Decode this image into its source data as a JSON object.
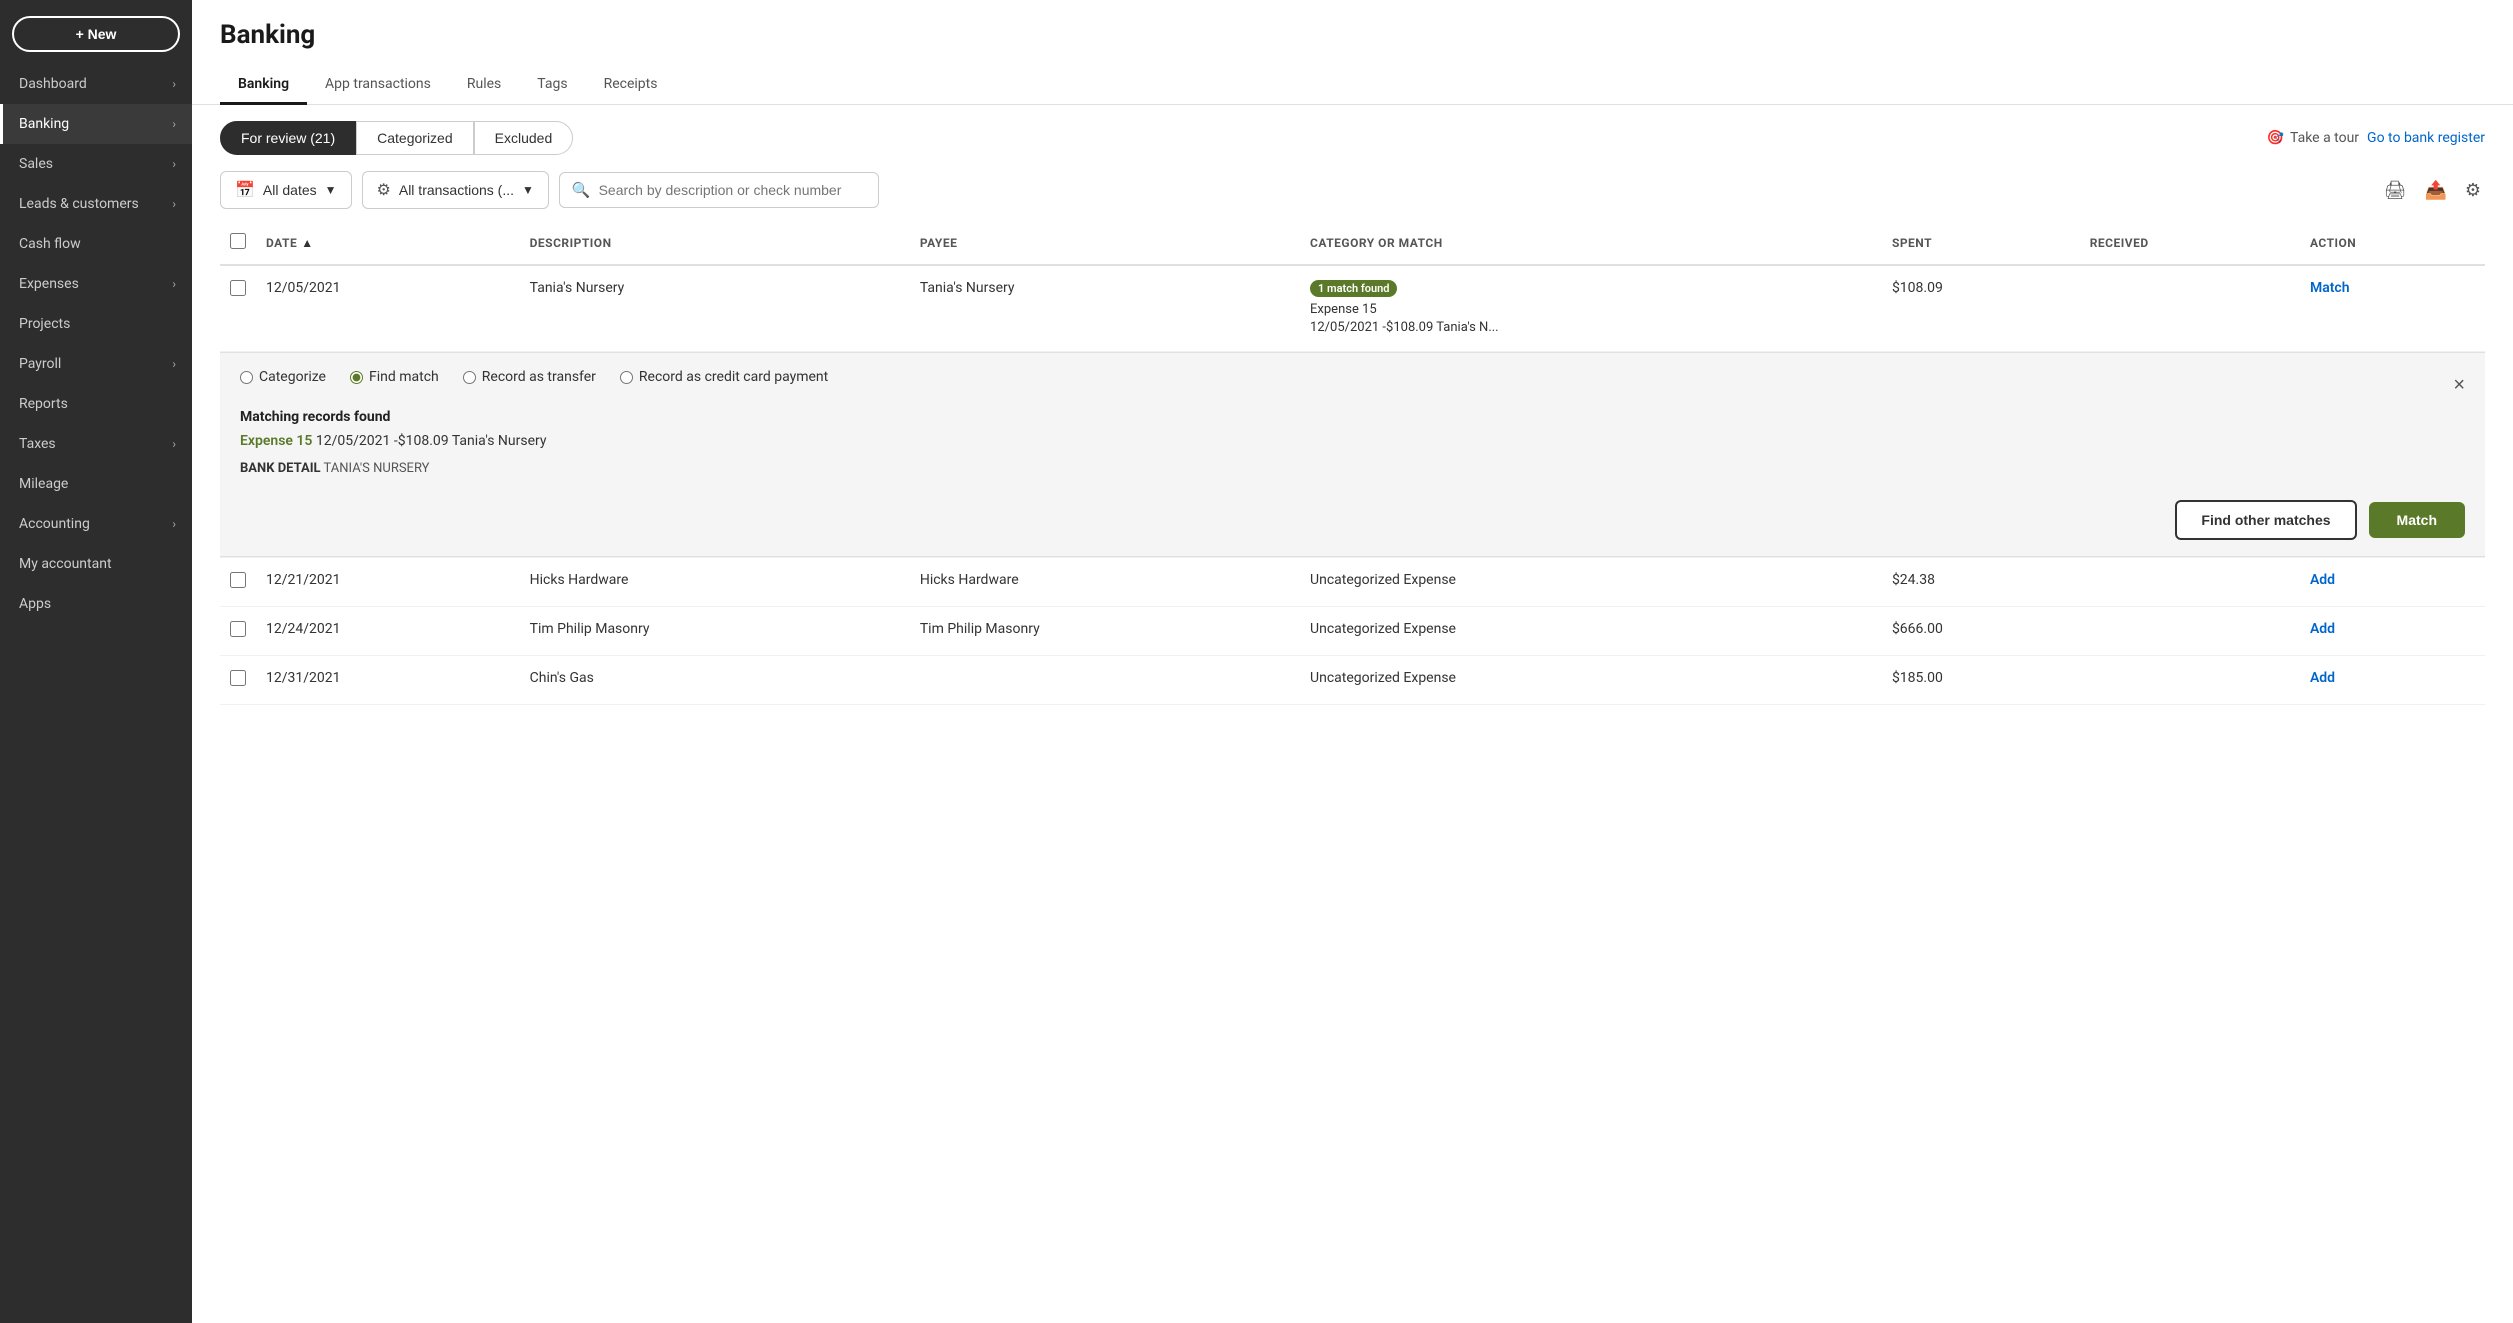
{
  "sidebar": {
    "new_button": "+ New",
    "items": [
      {
        "id": "dashboard",
        "label": "Dashboard",
        "hasChevron": true,
        "active": false
      },
      {
        "id": "banking",
        "label": "Banking",
        "hasChevron": true,
        "active": true
      },
      {
        "id": "sales",
        "label": "Sales",
        "hasChevron": true,
        "active": false
      },
      {
        "id": "leads",
        "label": "Leads & customers",
        "hasChevron": true,
        "active": false
      },
      {
        "id": "cashflow",
        "label": "Cash flow",
        "hasChevron": false,
        "active": false
      },
      {
        "id": "expenses",
        "label": "Expenses",
        "hasChevron": true,
        "active": false
      },
      {
        "id": "projects",
        "label": "Projects",
        "hasChevron": false,
        "active": false
      },
      {
        "id": "payroll",
        "label": "Payroll",
        "hasChevron": true,
        "active": false
      },
      {
        "id": "reports",
        "label": "Reports",
        "hasChevron": false,
        "active": false
      },
      {
        "id": "taxes",
        "label": "Taxes",
        "hasChevron": true,
        "active": false
      },
      {
        "id": "mileage",
        "label": "Mileage",
        "hasChevron": false,
        "active": false
      },
      {
        "id": "accounting",
        "label": "Accounting",
        "hasChevron": true,
        "active": false
      },
      {
        "id": "myaccountant",
        "label": "My accountant",
        "hasChevron": false,
        "active": false
      },
      {
        "id": "apps",
        "label": "Apps",
        "hasChevron": false,
        "active": false
      }
    ]
  },
  "page": {
    "title": "Banking",
    "tabs": [
      {
        "id": "banking",
        "label": "Banking",
        "active": true
      },
      {
        "id": "app-transactions",
        "label": "App transactions",
        "active": false
      },
      {
        "id": "rules",
        "label": "Rules",
        "active": false
      },
      {
        "id": "tags",
        "label": "Tags",
        "active": false
      },
      {
        "id": "receipts",
        "label": "Receipts",
        "active": false
      }
    ],
    "review_buttons": [
      {
        "id": "for-review",
        "label": "For review (21)",
        "active": true
      },
      {
        "id": "categorized",
        "label": "Categorized",
        "active": false
      },
      {
        "id": "excluded",
        "label": "Excluded",
        "active": false
      }
    ],
    "filters": {
      "date_label": "All dates",
      "date_icon": "📅",
      "transactions_label": "All transactions (...",
      "transactions_icon": "⚙"
    },
    "search_placeholder": "Search by description or check number",
    "tour_link": "Take a tour",
    "register_link": "Go to bank register",
    "table": {
      "columns": [
        {
          "id": "date",
          "label": "DATE",
          "sortable": true
        },
        {
          "id": "description",
          "label": "DESCRIPTION",
          "sortable": false
        },
        {
          "id": "payee",
          "label": "PAYEE",
          "sortable": false
        },
        {
          "id": "category",
          "label": "CATEGORY OR MATCH",
          "sortable": false
        },
        {
          "id": "spent",
          "label": "SPENT",
          "sortable": false
        },
        {
          "id": "received",
          "label": "RECEIVED",
          "sortable": false
        },
        {
          "id": "action",
          "label": "ACTION",
          "sortable": false
        }
      ],
      "rows": [
        {
          "id": "row1",
          "date": "12/05/2021",
          "description": "Tania's Nursery",
          "payee": "Tania's Nursery",
          "category_badge": "1 match found",
          "category_detail1": "Expense 15",
          "category_detail2": "12/05/2021 -$108.09 Tania's N...",
          "spent": "$108.09",
          "received": "",
          "action": "Match",
          "expanded": true
        },
        {
          "id": "row2",
          "date": "12/21/2021",
          "description": "Hicks Hardware",
          "payee": "Hicks Hardware",
          "category": "Uncategorized Expense",
          "spent": "$24.38",
          "received": "",
          "action": "Add",
          "expanded": false
        },
        {
          "id": "row3",
          "date": "12/24/2021",
          "description": "Tim Philip Masonry",
          "payee": "Tim Philip Masonry",
          "category": "Uncategorized Expense",
          "spent": "$666.00",
          "received": "",
          "action": "Add",
          "expanded": false
        },
        {
          "id": "row4",
          "date": "12/31/2021",
          "description": "Chin's Gas",
          "payee": "",
          "category": "Uncategorized Expense",
          "spent": "$185.00",
          "received": "",
          "action": "Add",
          "expanded": false
        }
      ]
    },
    "expanded_panel": {
      "radio_options": [
        {
          "id": "categorize",
          "label": "Categorize",
          "checked": false
        },
        {
          "id": "find-match",
          "label": "Find match",
          "checked": true
        },
        {
          "id": "record-transfer",
          "label": "Record as transfer",
          "checked": false
        },
        {
          "id": "record-credit",
          "label": "Record as credit card payment",
          "checked": false
        }
      ],
      "matching_title": "Matching records found",
      "matching_record_link": "Expense 15",
      "matching_record_detail": "12/05/2021 -$108.09 Tania's Nursery",
      "bank_detail_label": "BANK DETAIL",
      "bank_detail_value": "TANIA'S NURSERY",
      "find_other_matches_label": "Find other matches",
      "match_label": "Match"
    }
  }
}
